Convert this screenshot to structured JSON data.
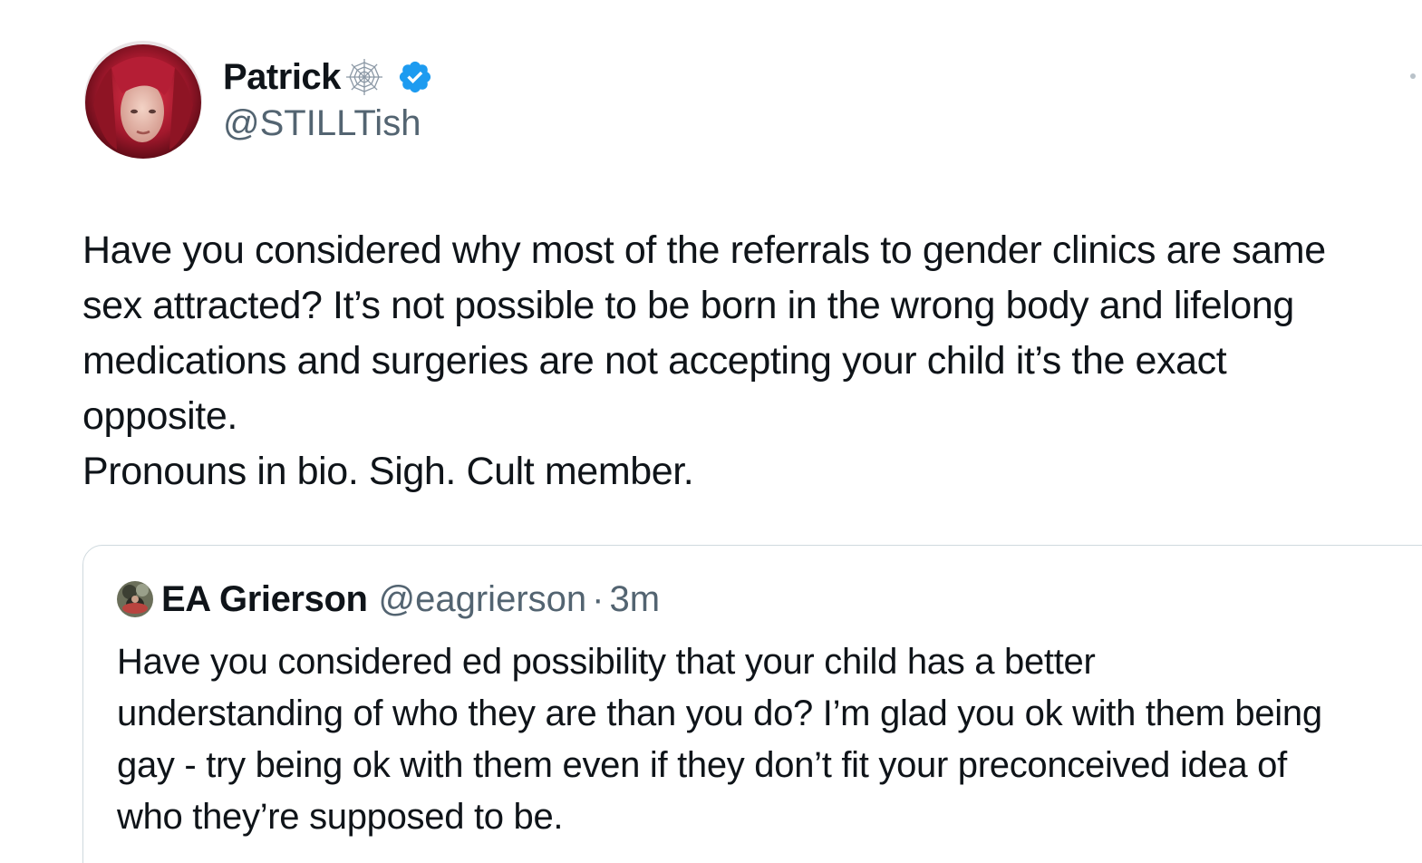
{
  "author": {
    "display_name": "Patrick",
    "handle": "@STILLTish",
    "name_emoji": "spider-web-icon",
    "verified_badge": "verified-icon",
    "verified_color": "#1d9bf0"
  },
  "tweet": {
    "lines": [
      "Have you considered why most of the referrals to gender clinics are same",
      "sex attracted? It’s not possible to be born in the wrong body and lifelong",
      "medications and surgeries are not accepting your child it’s the exact",
      "opposite.",
      "Pronouns in bio. Sigh. Cult member."
    ]
  },
  "quoted_tweet": {
    "display_name": "EA Grierson",
    "handle": "@eagrierson",
    "separator": "·",
    "time": "3m",
    "lines": [
      "Have you considered ed possibility that your child has a better",
      "understanding of who they are than you do? I’m glad you ok with them being",
      "gay - try being ok with them even if they don’t fit your preconceived idea of",
      "who they’re supposed to be."
    ]
  },
  "colors": {
    "text_primary": "#0f1419",
    "text_secondary": "#536471",
    "border": "#cfd9de"
  }
}
